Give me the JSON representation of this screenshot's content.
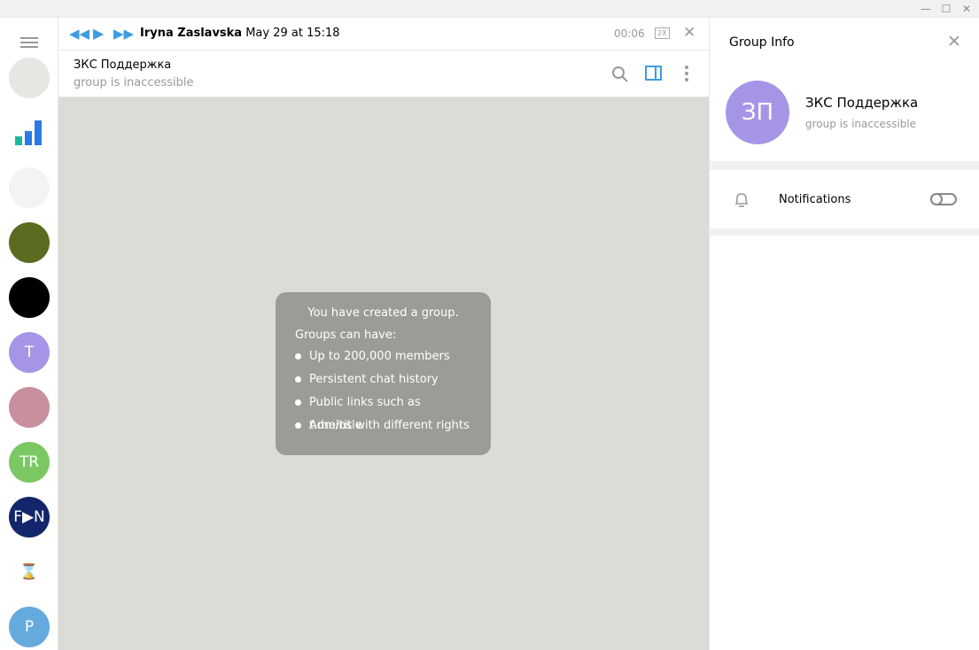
{
  "window": {
    "minimize": "—",
    "maximize": "☐",
    "close": "✕"
  },
  "sidebar": {
    "avatars": [
      {
        "name": "anime-cat",
        "initials": "",
        "color": "#e8e6e3"
      },
      {
        "name": "stats",
        "initials": "",
        "color": "#ffffff"
      },
      {
        "name": "growth-chart",
        "initials": "",
        "color": "#f3f3f3"
      },
      {
        "name": "sunflower",
        "initials": "",
        "color": "#5b6b1f"
      },
      {
        "name": "football",
        "initials": "",
        "color": "#000000"
      },
      {
        "name": "t",
        "initials": "T",
        "color": "#a695e7"
      },
      {
        "name": "anime-girl",
        "initials": "",
        "color": "#c7909c"
      },
      {
        "name": "tr",
        "initials": "TR",
        "color": "#7bc862"
      },
      {
        "name": "fan",
        "initials": "F▶N",
        "color": "#13266b"
      },
      {
        "name": "hourglass",
        "initials": "⌛",
        "color": "#ffffff"
      },
      {
        "name": "p",
        "initials": "P",
        "color": "#65aadd"
      }
    ]
  },
  "player": {
    "author": "Iryna Zaslavska",
    "date": "May 29 at 15:18",
    "time": "00:06",
    "speed": "2X"
  },
  "chat": {
    "title": "ЗКС Поддержка",
    "status": "group is inaccessible"
  },
  "service": {
    "title": "You have created a group.",
    "subtitle": "Groups can have:",
    "items": [
      "Up to 200,000 members",
      "Persistent chat history",
      "Public links such as t.me/title",
      "Admins with different rights"
    ]
  },
  "info": {
    "title": "Group Info",
    "initials": "ЗП",
    "avatar_color": "#a695e7",
    "name": "ЗКС Поддержка",
    "status": "group is inaccessible",
    "notifications_label": "Notifications",
    "notifications_on": false
  },
  "colors": {
    "accent": "#3d9de0"
  }
}
